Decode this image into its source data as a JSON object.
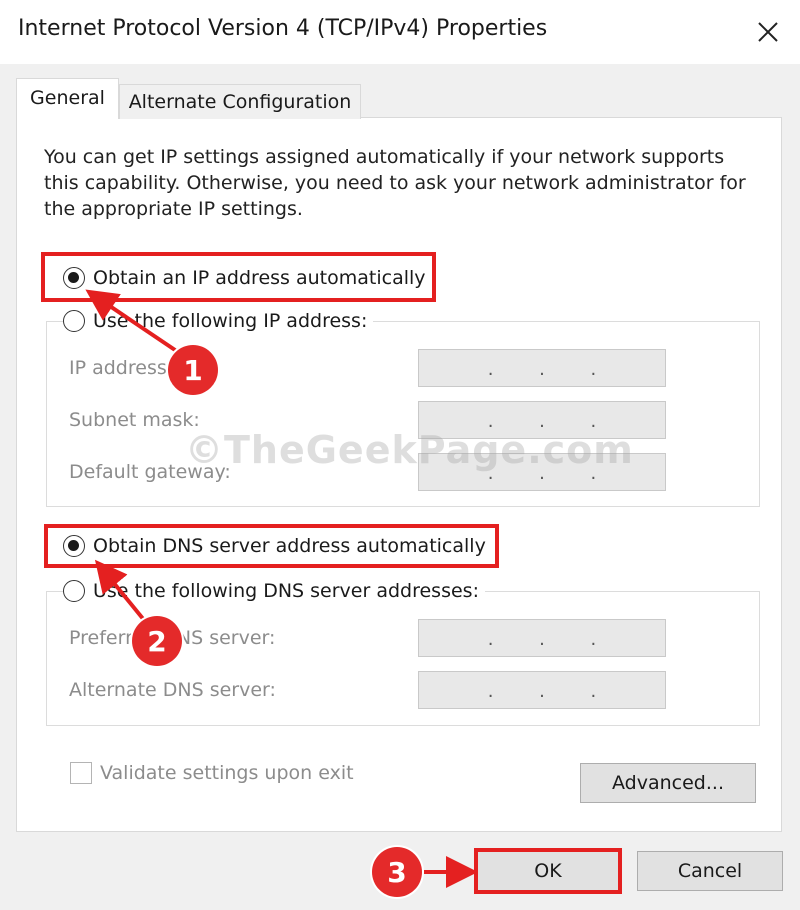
{
  "window": {
    "title": "Internet Protocol Version 4 (TCP/IPv4) Properties"
  },
  "tabs": [
    {
      "label": "General",
      "selected": true
    },
    {
      "label": "Alternate Configuration",
      "selected": false
    }
  ],
  "intro_text": "You can get IP settings assigned automatically if your network supports this capability. Otherwise, you need to ask your network administrator for the appropriate IP settings.",
  "ip_section": {
    "auto_option": {
      "label": "Obtain an IP address automatically",
      "checked": true
    },
    "manual_option": {
      "label": "Use the following IP address:",
      "checked": false
    },
    "fields": [
      {
        "label": "IP address:",
        "value": ".   .   ."
      },
      {
        "label": "Subnet mask:",
        "value": ".   .   ."
      },
      {
        "label": "Default gateway:",
        "value": ".   .   ."
      }
    ]
  },
  "dns_section": {
    "auto_option": {
      "label": "Obtain DNS server address automatically",
      "checked": true
    },
    "manual_option": {
      "label": "Use the following DNS server addresses:",
      "checked": false
    },
    "fields": [
      {
        "label": "Preferred DNS server:",
        "value": ".   .   ."
      },
      {
        "label": "Alternate DNS server:",
        "value": ".   .   ."
      }
    ]
  },
  "validate_checkbox": {
    "label": "Validate settings upon exit",
    "checked": false
  },
  "buttons": {
    "advanced": "Advanced...",
    "ok": "OK",
    "cancel": "Cancel"
  },
  "annotations": {
    "step1": "1",
    "step2": "2",
    "step3": "3",
    "watermark": "©TheGeekPage.com",
    "color": "#e42020"
  },
  "icons": {
    "close": "close-icon"
  }
}
